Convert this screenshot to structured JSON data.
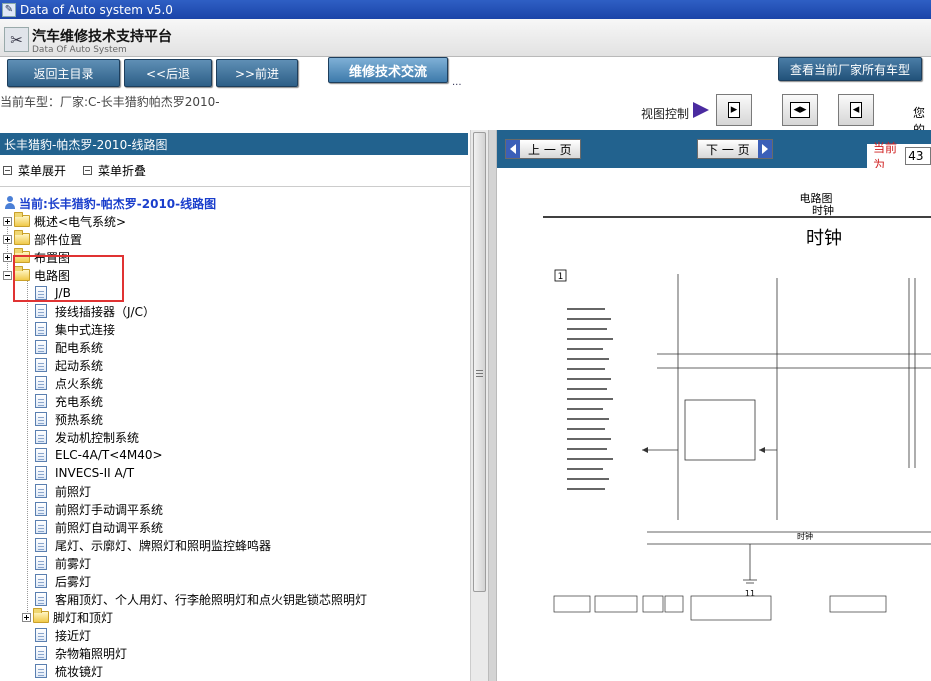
{
  "window": {
    "title": "Data of Auto system v5.0"
  },
  "header": {
    "title_cn": "汽车维修技术支持平台",
    "title_en": "Data Of Auto System"
  },
  "nav": {
    "home": "返回主目录",
    "back": "<<后退",
    "forward": ">>前进",
    "tech": "维修技术交流",
    "tech_dots": "...",
    "all_models": "查看当前厂家所有车型"
  },
  "car_bar": {
    "current": "当前车型：厂家:C-长丰猎豹帕杰罗2010-",
    "view_control": "视图控制",
    "user_partial": "您的"
  },
  "left": {
    "header": "长丰猎豹-帕杰罗-2010-线路图",
    "expand_all": "菜单展开",
    "collapse_all": "菜单折叠",
    "current_node": "当前:长丰猎豹-帕杰罗-2010-线路图",
    "folders": [
      {
        "label": "概述<电气系统>"
      },
      {
        "label": "部件位置"
      },
      {
        "label": "布置图"
      },
      {
        "label": "电路图"
      }
    ],
    "pages": [
      {
        "label": "J/B"
      },
      {
        "label": "接线插接器（J/C）"
      },
      {
        "label": "集中式连接"
      },
      {
        "label": "配电系统"
      },
      {
        "label": "起动系统"
      },
      {
        "label": "点火系统"
      },
      {
        "label": "充电系统"
      },
      {
        "label": "预热系统"
      },
      {
        "label": "发动机控制系统"
      },
      {
        "label": "ELC-4A/T<4M40>"
      },
      {
        "label": "INVECS-II A/T"
      },
      {
        "label": "前照灯"
      },
      {
        "label": "前照灯手动调平系统"
      },
      {
        "label": "前照灯自动调平系统"
      },
      {
        "label": "尾灯、示廓灯、牌照灯和照明监控蜂鸣器"
      },
      {
        "label": "前雾灯"
      },
      {
        "label": "后雾灯"
      },
      {
        "label": "客厢顶灯、个人用灯、行李舱照明灯和点火钥匙锁芯照明灯"
      }
    ],
    "subfolder": {
      "label": "脚灯和顶灯"
    },
    "pages2": [
      {
        "label": "接近灯"
      },
      {
        "label": "杂物箱照明灯"
      },
      {
        "label": "梳妆镜灯"
      }
    ]
  },
  "right": {
    "prev_page": "上 一 页",
    "next_page": "下 一 页",
    "current_label": "当前为",
    "current_value": "43"
  },
  "diagram": {
    "section": "电路图",
    "subtitle": "时钟",
    "big_title": "时钟",
    "page_num": "1",
    "bus_label": "时钟",
    "ground_num": "11"
  }
}
